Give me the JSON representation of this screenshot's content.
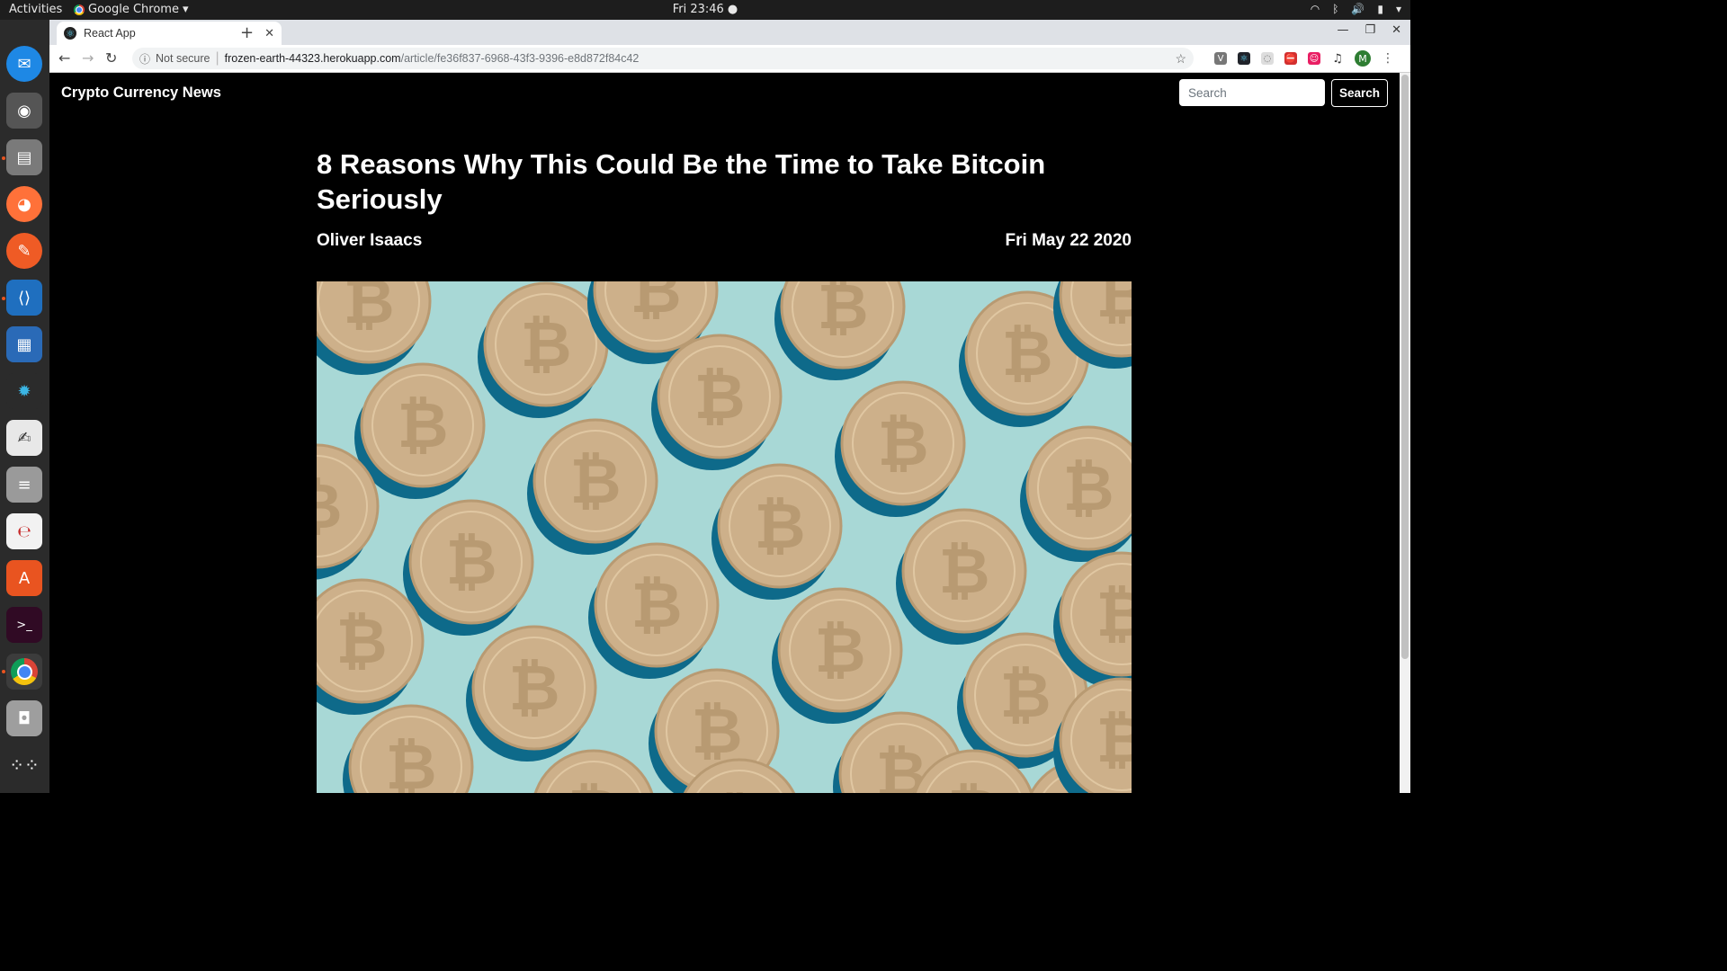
{
  "system": {
    "activities": "Activities",
    "app_menu": "Google Chrome",
    "clock": "Fri 23:46"
  },
  "browser": {
    "tab_title": "React App",
    "security_label": "Not secure",
    "url_host": "frozen-earth-44323.herokuapp.com",
    "url_path": "/article/fe36f837-6968-43f3-9396-e8d872f84c42",
    "profile_initial": "M"
  },
  "site": {
    "brand": "Crypto Currency News",
    "search_placeholder": "Search",
    "search_button": "Search"
  },
  "article": {
    "title": "8 Reasons Why This Could Be the Time to Take Bitcoin Seriously",
    "author": "Oliver Isaacs",
    "date": "Fri May 22 2020"
  },
  "dock": {
    "items": [
      "thunderbird-icon",
      "rhythmbox-icon",
      "files-icon",
      "firefox-icon",
      "postman-icon",
      "vscode-icon",
      "writer-icon",
      "kstars-icon",
      "text-editor-icon",
      "database-icon",
      "evince-icon",
      "software-center-icon",
      "terminal-icon",
      "chrome-icon",
      "screenshot-icon",
      "show-apps-icon"
    ]
  },
  "colors": {
    "page_bg": "#000000",
    "hero_bg": "#a8d8d6",
    "coin": "#cdb08a",
    "coin_shadow": "#0e6a8a"
  }
}
